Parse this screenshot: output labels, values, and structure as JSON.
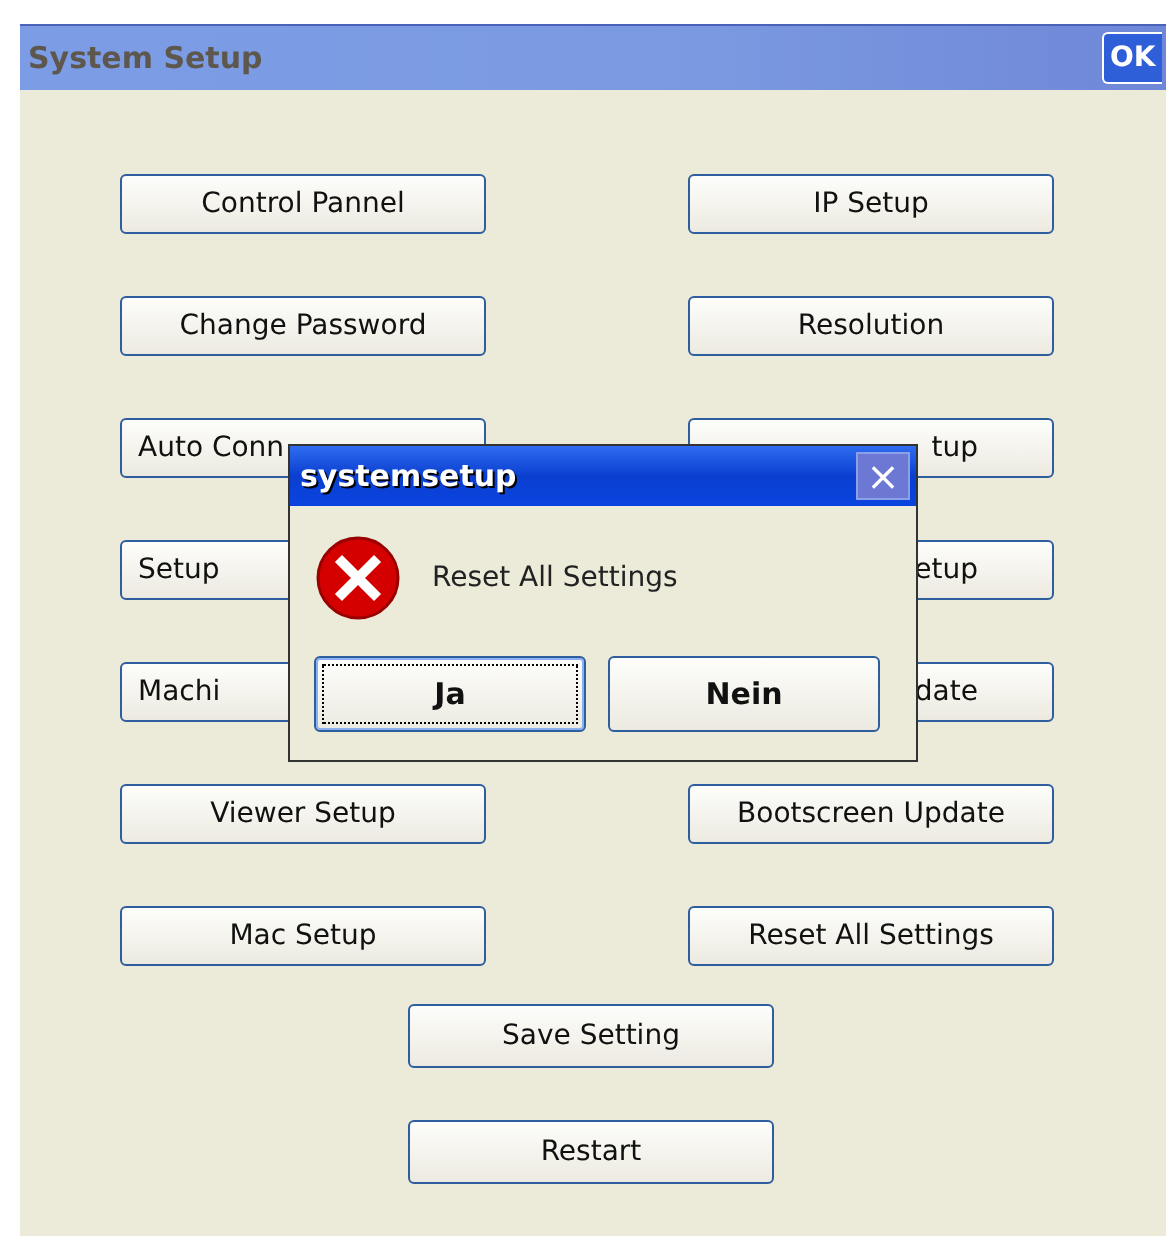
{
  "window": {
    "title": "System Setup",
    "ok_button": "OK"
  },
  "buttons": [
    {
      "label": "Control Pannel",
      "kind": "whole"
    },
    {
      "label": "IP Setup",
      "kind": "whole"
    },
    {
      "label": "Change Password",
      "kind": "whole"
    },
    {
      "label": "Resolution",
      "kind": "whole"
    },
    {
      "label": "Auto Conn",
      "kind": "head"
    },
    {
      "label": "tup",
      "kind": "tail"
    },
    {
      "label": "Setup",
      "kind": "head"
    },
    {
      "label": "etup",
      "kind": "tail"
    },
    {
      "label": "Machi",
      "kind": "head"
    },
    {
      "label": "date",
      "kind": "tail"
    },
    {
      "label": "Viewer Setup",
      "kind": "whole"
    },
    {
      "label": "Bootscreen Update",
      "kind": "whole"
    },
    {
      "label": "Mac Setup",
      "kind": "whole"
    },
    {
      "label": "Reset All Settings",
      "kind": "whole"
    }
  ],
  "bottom_buttons": [
    "Save Setting",
    "Restart"
  ],
  "dialog": {
    "title": "systemsetup",
    "close": "×",
    "message": "Reset All Settings",
    "buttons": [
      {
        "label": "Ja",
        "focused": true
      },
      {
        "label": "Nein",
        "focused": false
      }
    ]
  }
}
